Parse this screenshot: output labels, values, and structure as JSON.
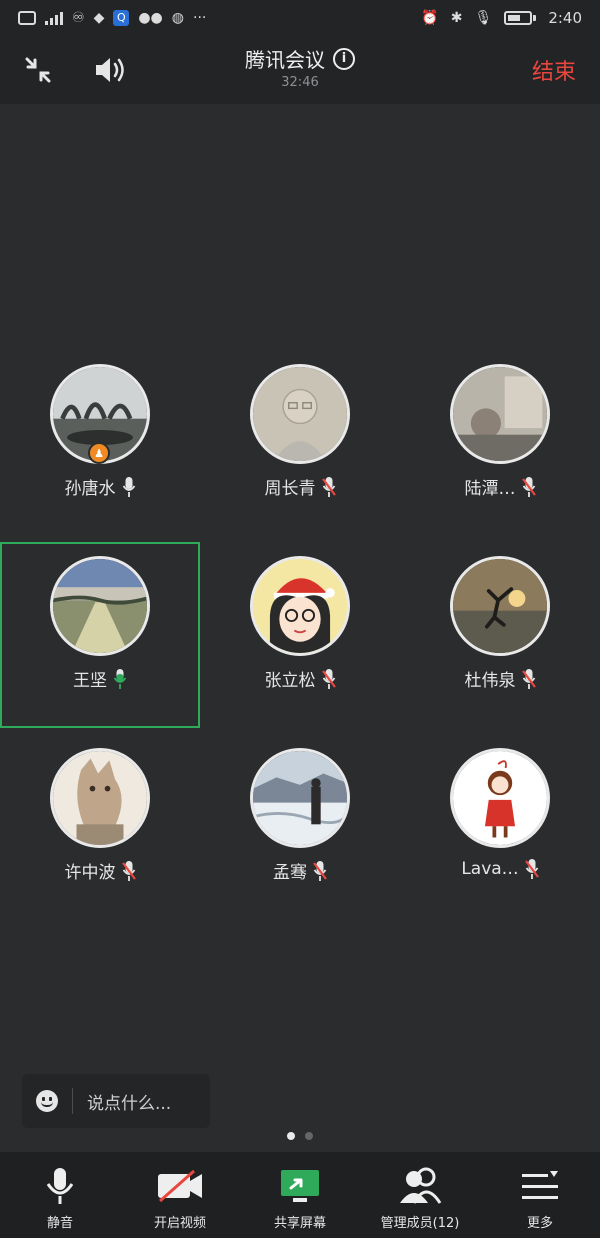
{
  "status_bar": {
    "left_icons": [
      "hd-icon",
      "signal-icon",
      "data-icon",
      "qq-icon",
      "app-icon",
      "wechat-icon",
      "message-icon",
      "more-dots-icon"
    ],
    "right_icons": [
      "alarm-icon",
      "bluetooth-icon",
      "mic-icon",
      "battery-icon"
    ],
    "time": "2:40"
  },
  "header": {
    "title": "腾讯会议",
    "duration": "32:46",
    "end_label": "结束",
    "end_color": "#e8473f"
  },
  "participants": [
    {
      "name": "孙唐水",
      "mic": "on",
      "host": true
    },
    {
      "name": "周长青",
      "mic": "muted"
    },
    {
      "name": "陆潭…",
      "mic": "muted"
    },
    {
      "name": "王坚",
      "mic": "speaking",
      "active": true
    },
    {
      "name": "张立松",
      "mic": "muted"
    },
    {
      "name": "杜伟泉",
      "mic": "muted"
    },
    {
      "name": "许中波",
      "mic": "muted"
    },
    {
      "name": "孟骞",
      "mic": "muted"
    },
    {
      "name": "Lava…",
      "mic": "muted"
    }
  ],
  "chat": {
    "placeholder": "说点什么..."
  },
  "pager": {
    "pages": 2,
    "current": 1
  },
  "toolbar": {
    "mute_label": "静音",
    "video_label": "开启视频",
    "share_label": "共享屏幕",
    "members_label": "管理成员(12)",
    "more_label": "更多"
  },
  "colors": {
    "background": "#2b2c2e",
    "active_border": "#2eaa5a",
    "muted_red": "#e8473f",
    "share_green": "#2eaa5a"
  }
}
